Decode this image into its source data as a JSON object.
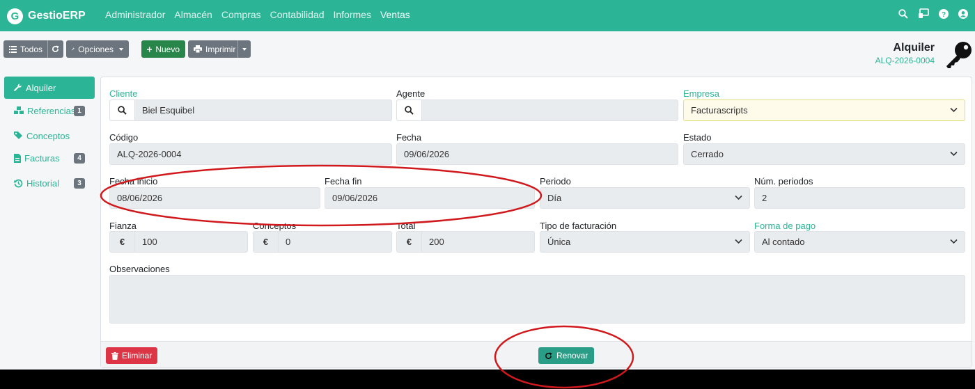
{
  "app": {
    "logo_letter": "G",
    "name": "GestioERP"
  },
  "nav": {
    "items": [
      "Administrador",
      "Almacén",
      "Compras",
      "Contabilidad",
      "Informes",
      "Ventas"
    ],
    "active_index": 5
  },
  "toolbar": {
    "all_label": "Todos",
    "options_label": "Opciones",
    "new_label": "Nuevo",
    "print_label": "Imprimir"
  },
  "header": {
    "title": "Alquiler",
    "code": "ALQ-2026-0004"
  },
  "sidebar": {
    "items": [
      {
        "label": "Alquiler",
        "icon": "wrench-icon",
        "badge": ""
      },
      {
        "label": "Referencias",
        "icon": "cubes-icon",
        "badge": "1"
      },
      {
        "label": "Conceptos",
        "icon": "tags-icon",
        "badge": ""
      },
      {
        "label": "Facturas",
        "icon": "invoice-icon",
        "badge": "4"
      },
      {
        "label": "Historial",
        "icon": "history-icon",
        "badge": "3"
      }
    ]
  },
  "form": {
    "cliente": {
      "label": "Cliente",
      "value": "Biel Esquibel"
    },
    "agente": {
      "label": "Agente",
      "value": ""
    },
    "empresa": {
      "label": "Empresa",
      "value": "Facturascripts"
    },
    "codigo": {
      "label": "Código",
      "value": "ALQ-2026-0004"
    },
    "fecha": {
      "label": "Fecha",
      "value": "09/06/2026"
    },
    "estado": {
      "label": "Estado",
      "value": "Cerrado"
    },
    "fecha_inicio": {
      "label": "Fecha inicio",
      "value": "08/06/2026"
    },
    "fecha_fin": {
      "label": "Fecha fin",
      "value": "09/06/2026"
    },
    "periodo": {
      "label": "Periodo",
      "value": "Día"
    },
    "num_periodos": {
      "label": "Núm. periodos",
      "value": "2"
    },
    "fianza": {
      "label": "Fianza",
      "currency": "€",
      "value": "100"
    },
    "conceptos": {
      "label": "Conceptos",
      "currency": "€",
      "value": "0"
    },
    "total": {
      "label": "Total",
      "currency": "€",
      "value": "200"
    },
    "tipo_facturacion": {
      "label": "Tipo de facturación",
      "value": "Única"
    },
    "forma_pago": {
      "label": "Forma de pago",
      "value": "Al contado"
    },
    "observaciones": {
      "label": "Observaciones",
      "value": ""
    }
  },
  "actions": {
    "delete_label": "Eliminar",
    "renew_label": "Renovar"
  },
  "colors": {
    "brand": "#2bb596",
    "danger": "#dc3545",
    "annotation": "#d0191c"
  }
}
